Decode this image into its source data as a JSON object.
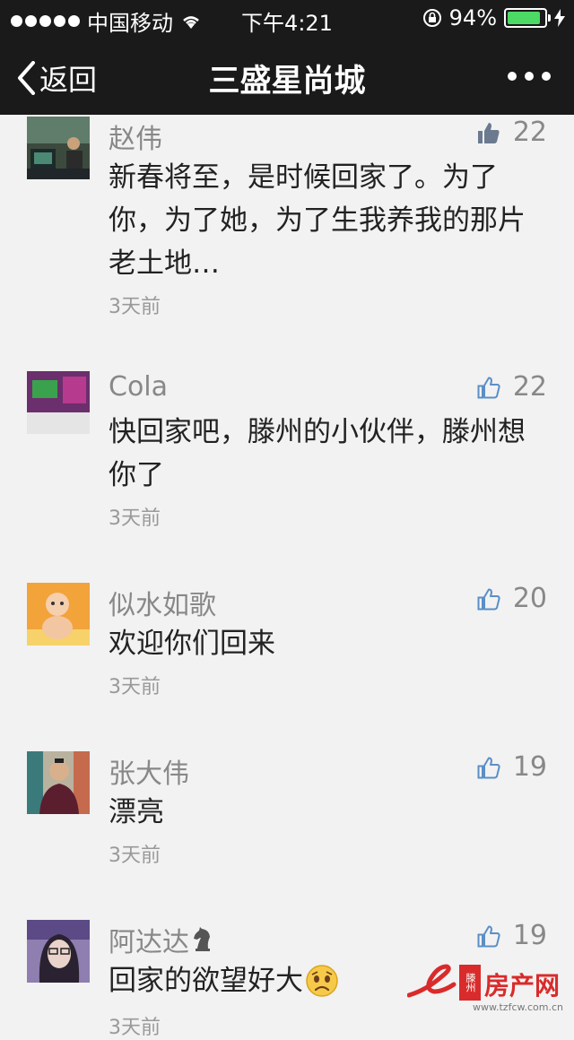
{
  "status_bar": {
    "carrier": "中国移动",
    "time": "下午4:21",
    "battery_text": "94%",
    "battery_level": 0.94,
    "battery_color": "#4cd964"
  },
  "nav": {
    "back_label": "返回",
    "title": "三盛星尚城",
    "more_icon": "more-dots-icon"
  },
  "comments": [
    {
      "author": "赵伟",
      "likes": "22",
      "liked": true,
      "text_lines": [
        "新春将至，是时候回家了。为了",
        "你，为了她，为了生我养我的那片",
        "老土地…"
      ],
      "time": "3天前"
    },
    {
      "author": "Cola",
      "likes": "22",
      "liked": false,
      "text_lines": [
        "快回家吧，滕州的小伙伴，滕州想",
        "你了"
      ],
      "time": "3天前"
    },
    {
      "author": "似水如歌",
      "likes": "20",
      "liked": false,
      "text_lines": [
        "欢迎你们回来"
      ],
      "time": "3天前"
    },
    {
      "author": "张大伟",
      "likes": "19",
      "liked": false,
      "text_lines": [
        "漂亮"
      ],
      "time": "3天前"
    },
    {
      "author": "阿达达",
      "likes": "19",
      "liked": false,
      "text_lines": [
        "回家的欲望好大"
      ],
      "time": "3天前"
    }
  ],
  "watermark": {
    "badge": "滕州",
    "name": "房产网",
    "url": "www.tzfcw.com.cn"
  },
  "colors": {
    "header_bg": "#1a1a1a",
    "page_bg": "#f2f2f2",
    "like_filled": "#6b7a8f",
    "like_outline": "#5b8fc7"
  }
}
